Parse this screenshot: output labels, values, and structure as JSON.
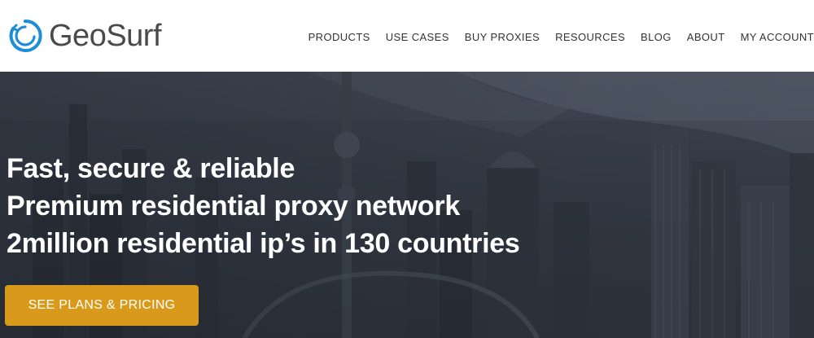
{
  "brand": {
    "name": "GeoSurf",
    "logo_icon": "geosurf-swirl-icon",
    "logo_color": "#1e8fd6"
  },
  "nav": {
    "items": [
      {
        "label": "PRODUCTS"
      },
      {
        "label": "USE CASES"
      },
      {
        "label": "BUY PROXIES"
      },
      {
        "label": "RESOURCES"
      },
      {
        "label": "BLOG"
      },
      {
        "label": "ABOUT"
      },
      {
        "label": "MY ACCOUNT"
      }
    ]
  },
  "hero": {
    "lines": [
      "Fast, secure & reliable",
      "Premium residential proxy network",
      "2million residential ip’s in 130 countries"
    ],
    "cta_label": "SEE PLANS & PRICING",
    "cta_color": "#d99a1c"
  }
}
